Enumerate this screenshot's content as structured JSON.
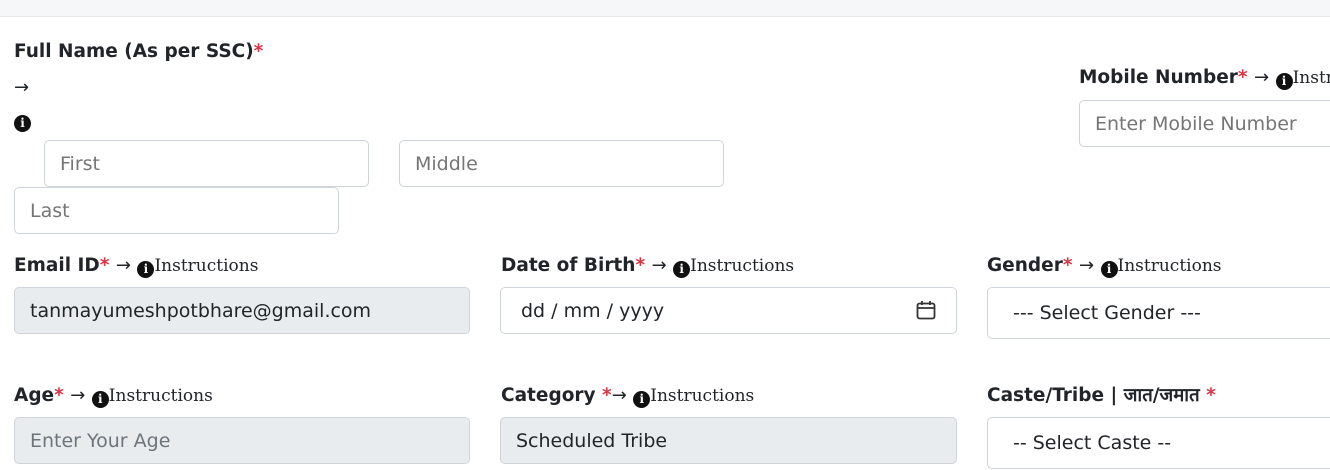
{
  "form": {
    "full_name": {
      "label": "Full Name (As per SSC)",
      "required_mark": "*",
      "arrow": "→",
      "first_placeholder": "First",
      "middle_placeholder": "Middle",
      "last_placeholder": "Last"
    },
    "mobile": {
      "label": "Mobile Number",
      "required_mark": "*",
      "arrow": "→",
      "instructions": "Instr",
      "placeholder": "Enter Mobile Number"
    },
    "email": {
      "label": "Email ID",
      "required_mark": "*",
      "arrow": "→",
      "instructions": "Instructions",
      "value": "tanmayumeshpotbhare@gmail.com"
    },
    "dob": {
      "label": "Date of Birth",
      "required_mark": "*",
      "arrow": "→",
      "instructions": "Instructions",
      "placeholder": "dd / mm / yyyy"
    },
    "gender": {
      "label": "Gender",
      "required_mark": "*",
      "arrow": "→",
      "instructions": "Instructions",
      "selected": "--- Select Gender ---"
    },
    "age": {
      "label": "Age",
      "required_mark": "*",
      "arrow": "→",
      "instructions": "Instructions",
      "placeholder": "Enter Your Age"
    },
    "category": {
      "label": "Category ",
      "required_mark": "*",
      "arrow": "→",
      "instructions": "Instructions",
      "value": "Scheduled Tribe"
    },
    "caste": {
      "label": "Caste/Tribe | जात/जमात ",
      "required_mark": "*",
      "selected": "-- Select Caste --"
    }
  },
  "icons": {
    "info": "info-circle-icon",
    "calendar": "calendar-icon"
  },
  "colors": {
    "required": "#dc3545",
    "disabled_bg": "#e9ecef",
    "border": "#ced4da"
  }
}
